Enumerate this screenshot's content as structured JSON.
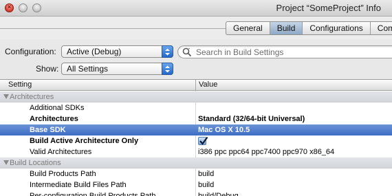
{
  "window": {
    "title": "Project “SomeProject” Info"
  },
  "tabs": [
    {
      "label": "General",
      "active": false
    },
    {
      "label": "Build",
      "active": true
    },
    {
      "label": "Configurations",
      "active": false
    },
    {
      "label": "Com",
      "active": false
    }
  ],
  "configuration": {
    "label": "Configuration:",
    "value": "Active (Debug)"
  },
  "show": {
    "label": "Show:",
    "value": "All Settings"
  },
  "search": {
    "placeholder": "Search in Build Settings"
  },
  "table": {
    "col_setting": "Setting",
    "col_value": "Value",
    "rows": [
      {
        "type": "group",
        "name": "Architectures",
        "value": ""
      },
      {
        "type": "item",
        "name": "Additional SDKs",
        "value": ""
      },
      {
        "type": "item",
        "bold": true,
        "name": "Architectures",
        "value": "Standard (32/64-bit Universal)"
      },
      {
        "type": "item",
        "bold": true,
        "selected": true,
        "name": "Base SDK",
        "value": "Mac OS X 10.5"
      },
      {
        "type": "item",
        "bold": true,
        "name": "Build Active Architecture Only",
        "checked": true
      },
      {
        "type": "item",
        "name": "Valid Architectures",
        "value": "i386 ppc ppc64 ppc7400 ppc970 x86_64"
      },
      {
        "type": "group",
        "name": "Build Locations",
        "value": ""
      },
      {
        "type": "item",
        "name": "Build Products Path",
        "value": "build"
      },
      {
        "type": "item",
        "name": "Intermediate Build Files Path",
        "value": "build"
      },
      {
        "type": "item",
        "name": "Per-configuration Build Products Path",
        "value": "build/Debug"
      }
    ]
  },
  "colors": {
    "selection": "#3c6cc4",
    "group_bg": "#d9dce0",
    "popup_accent": "#2467c6"
  }
}
